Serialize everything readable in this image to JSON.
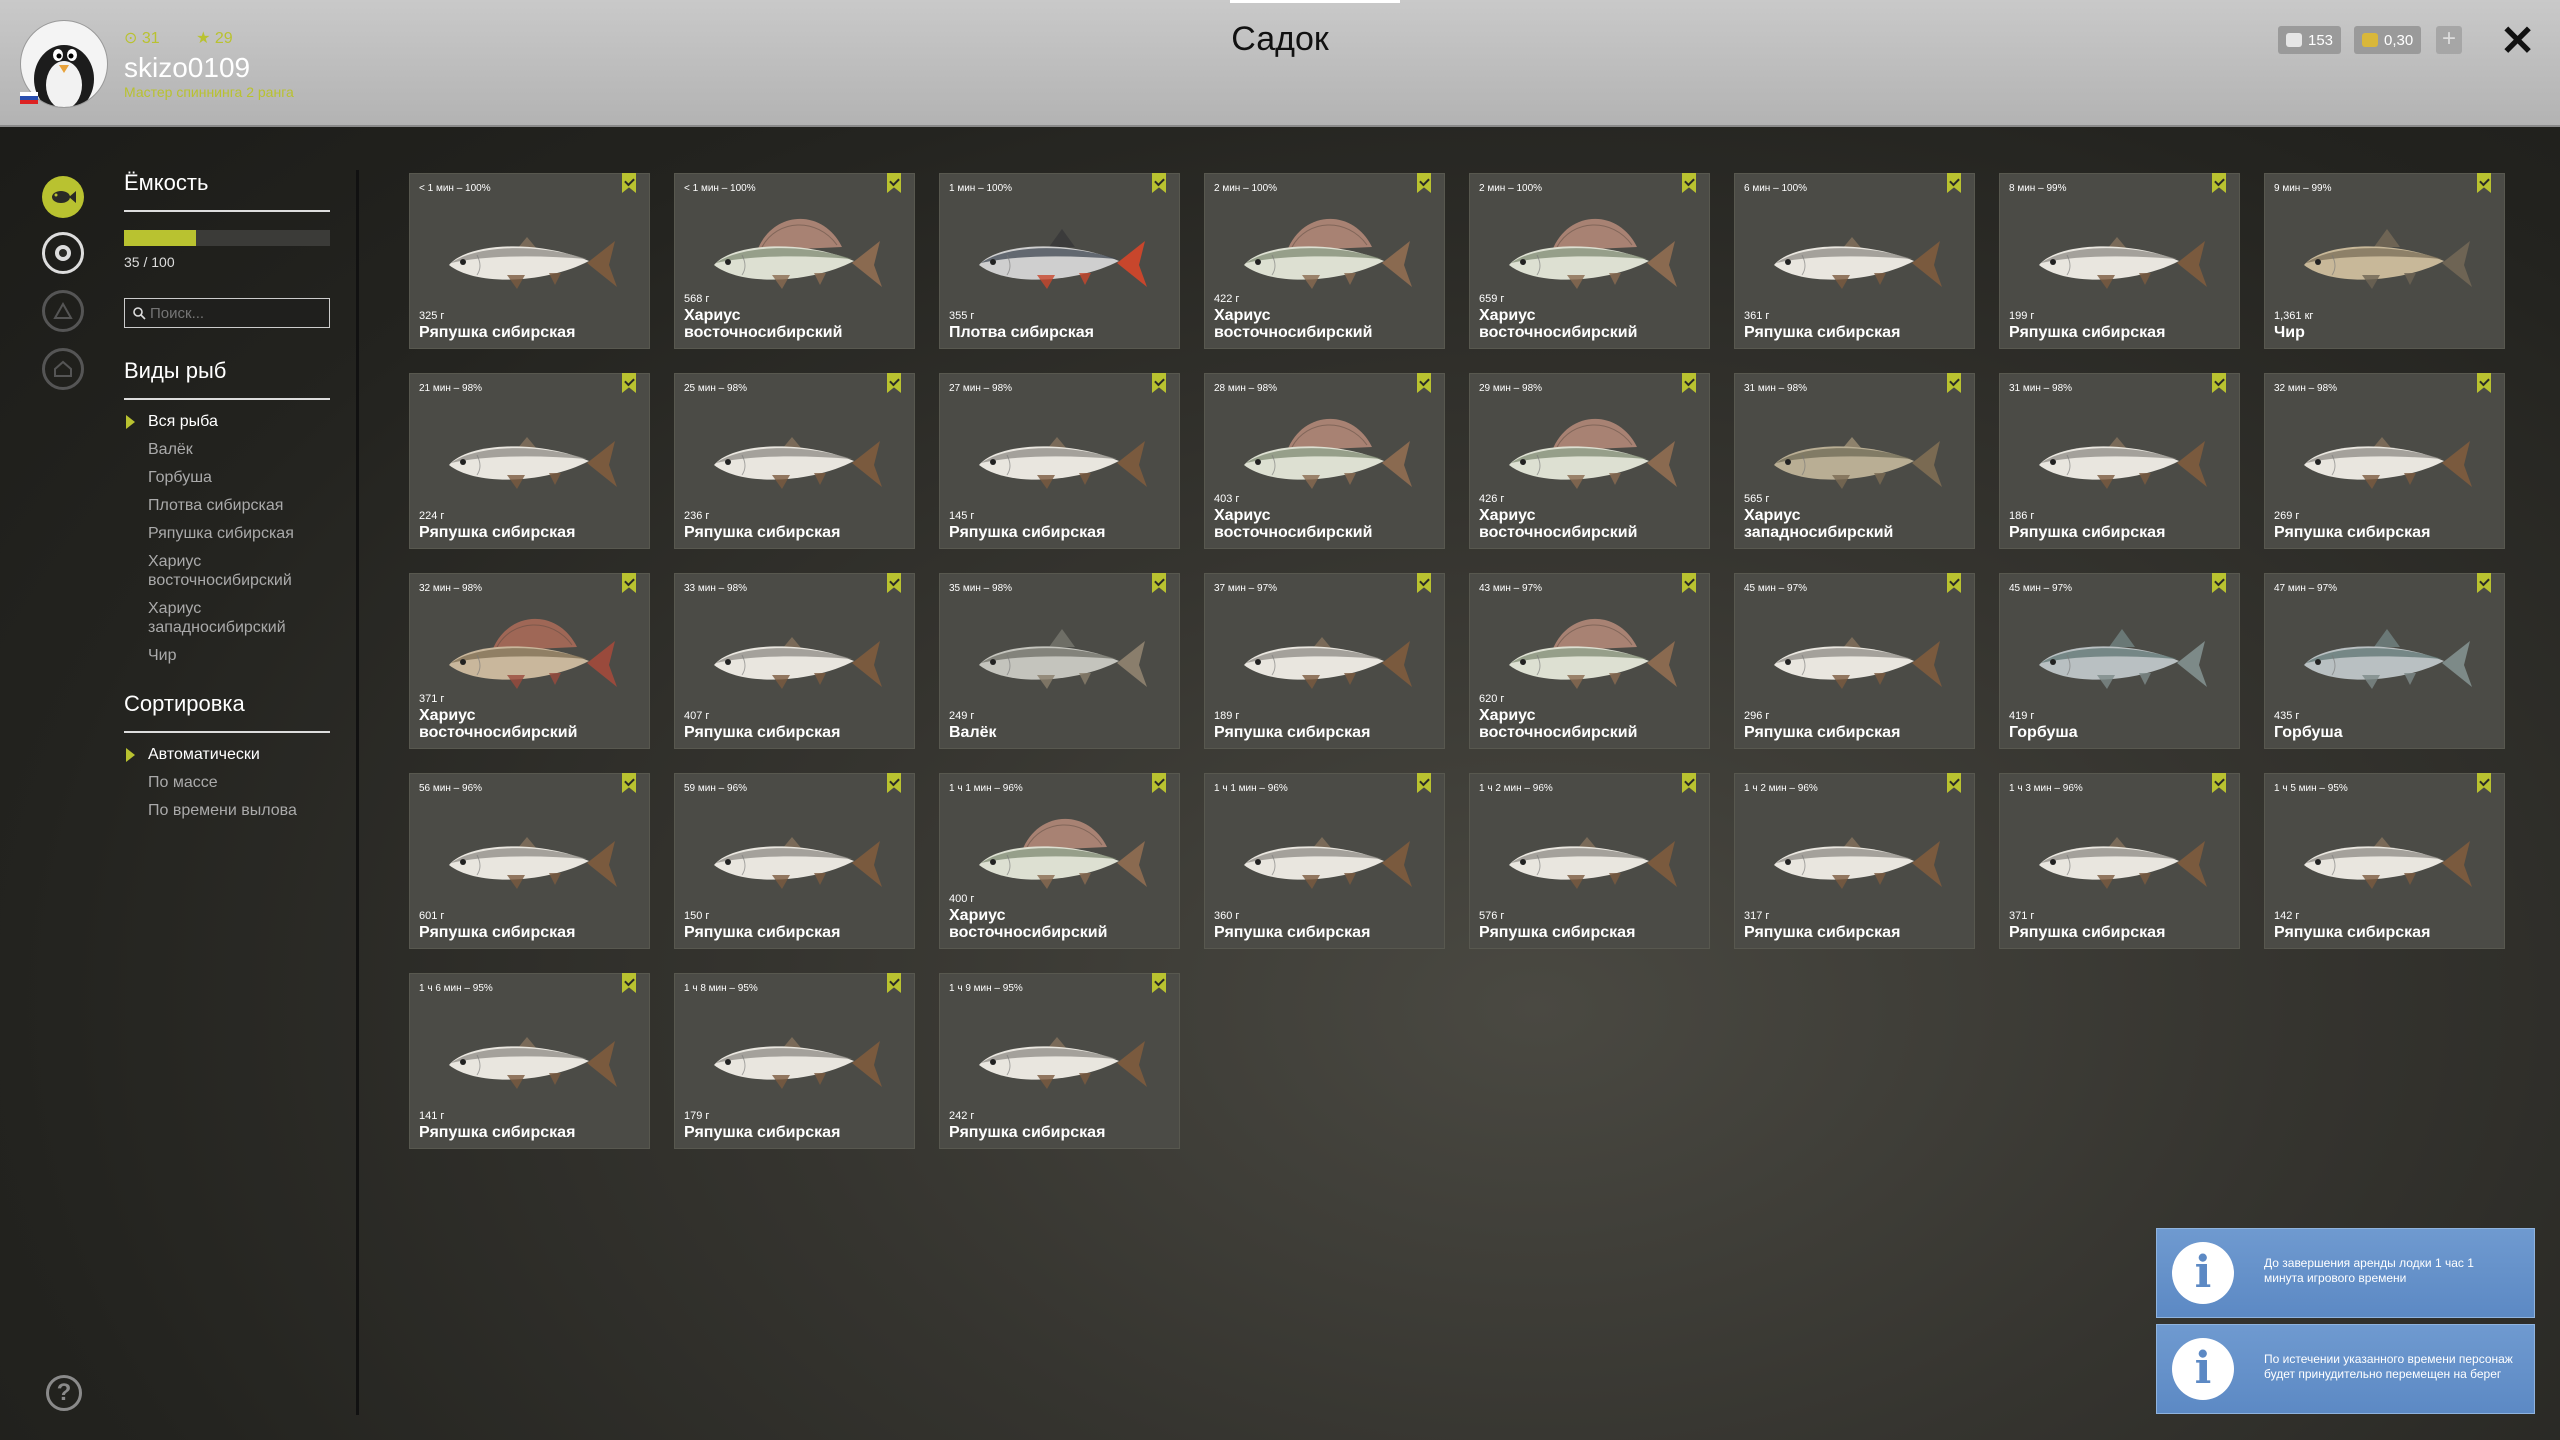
{
  "header": {
    "title": "Садок",
    "coins": "31",
    "stars": "29",
    "username": "skizo0109",
    "rank": "Мастер спиннинга 2 ранга",
    "silver": "153",
    "gold": "0,30"
  },
  "sidebar": {
    "capacity_title": "Ёмкость",
    "capacity_value": "35 / 100",
    "capacity_fraction": 0.35,
    "search_placeholder": "Поиск...",
    "species_title": "Виды рыб",
    "species": [
      "Вся рыба",
      "Валёк",
      "Горбуша",
      "Плотва сибирская",
      "Ряпушка сибирская",
      "Хариус восточносибирский",
      "Хариус западносибирский",
      "Чир"
    ],
    "sort_title": "Сортировка",
    "sort": [
      "Автоматически",
      "По массе",
      "По времени вылова"
    ]
  },
  "fish": [
    {
      "time": "< 1 мин – 100%",
      "weight": "325 г",
      "name": "Ряпушка сибирская",
      "kind": "ryap"
    },
    {
      "time": "< 1 мин – 100%",
      "weight": "568 г",
      "name": "Хариус восточносибирский",
      "kind": "harv"
    },
    {
      "time": "1 мин – 100%",
      "weight": "355 г",
      "name": "Плотва сибирская",
      "kind": "plot"
    },
    {
      "time": "2 мин – 100%",
      "weight": "422 г",
      "name": "Хариус восточносибирский",
      "kind": "harv"
    },
    {
      "time": "2 мин – 100%",
      "weight": "659 г",
      "name": "Хариус восточносибирский",
      "kind": "harv"
    },
    {
      "time": "6 мин – 100%",
      "weight": "361 г",
      "name": "Ряпушка сибирская",
      "kind": "ryap"
    },
    {
      "time": "8 мин – 99%",
      "weight": "199 г",
      "name": "Ряпушка сибирская",
      "kind": "ryap"
    },
    {
      "time": "9 мин – 99%",
      "weight": "1,361 кг",
      "name": "Чир",
      "kind": "chir"
    },
    {
      "time": "21 мин – 98%",
      "weight": "224 г",
      "name": "Ряпушка сибирская",
      "kind": "ryap"
    },
    {
      "time": "25 мин – 98%",
      "weight": "236 г",
      "name": "Ряпушка сибирская",
      "kind": "ryap"
    },
    {
      "time": "27 мин – 98%",
      "weight": "145 г",
      "name": "Ряпушка сибирская",
      "kind": "ryap"
    },
    {
      "time": "28 мин – 98%",
      "weight": "403 г",
      "name": "Хариус восточносибирский",
      "kind": "harv"
    },
    {
      "time": "29 мин – 98%",
      "weight": "426 г",
      "name": "Хариус восточносибирский",
      "kind": "harv"
    },
    {
      "time": "31 мин – 98%",
      "weight": "565 г",
      "name": "Хариус западносибирский",
      "kind": "harz"
    },
    {
      "time": "31 мин – 98%",
      "weight": "186 г",
      "name": "Ряпушка сибирская",
      "kind": "ryap"
    },
    {
      "time": "32 мин – 98%",
      "weight": "269 г",
      "name": "Ряпушка сибирская",
      "kind": "ryap"
    },
    {
      "time": "32 мин – 98%",
      "weight": "371 г",
      "name": "Хариус восточносибирский",
      "kind": "harr"
    },
    {
      "time": "33 мин – 98%",
      "weight": "407 г",
      "name": "Ряпушка сибирская",
      "kind": "ryap"
    },
    {
      "time": "35 мин – 98%",
      "weight": "249 г",
      "name": "Валёк",
      "kind": "valek"
    },
    {
      "time": "37 мин – 97%",
      "weight": "189 г",
      "name": "Ряпушка сибирская",
      "kind": "ryap"
    },
    {
      "time": "43 мин – 97%",
      "weight": "620 г",
      "name": "Хариус восточносибирский",
      "kind": "harv"
    },
    {
      "time": "45 мин – 97%",
      "weight": "296 г",
      "name": "Ряпушка сибирская",
      "kind": "ryap"
    },
    {
      "time": "45 мин – 97%",
      "weight": "419 г",
      "name": "Горбуша",
      "kind": "gorb"
    },
    {
      "time": "47 мин – 97%",
      "weight": "435 г",
      "name": "Горбуша",
      "kind": "gorb"
    },
    {
      "time": "56 мин – 96%",
      "weight": "601 г",
      "name": "Ряпушка сибирская",
      "kind": "ryap"
    },
    {
      "time": "59 мин – 96%",
      "weight": "150 г",
      "name": "Ряпушка сибирская",
      "kind": "ryap"
    },
    {
      "time": "1 ч 1 мин – 96%",
      "weight": "400 г",
      "name": "Хариус восточносибирский",
      "kind": "harv"
    },
    {
      "time": "1 ч 1 мин – 96%",
      "weight": "360 г",
      "name": "Ряпушка сибирская",
      "kind": "ryap"
    },
    {
      "time": "1 ч 2 мин – 96%",
      "weight": "576 г",
      "name": "Ряпушка сибирская",
      "kind": "ryap"
    },
    {
      "time": "1 ч 2 мин – 96%",
      "weight": "317 г",
      "name": "Ряпушка сибирская",
      "kind": "ryap"
    },
    {
      "time": "1 ч 3 мин – 96%",
      "weight": "371 г",
      "name": "Ряпушка сибирская",
      "kind": "ryap"
    },
    {
      "time": "1 ч 5 мин – 95%",
      "weight": "142 г",
      "name": "Ряпушка сибирская",
      "kind": "ryap"
    },
    {
      "time": "1 ч 6 мин – 95%",
      "weight": "141 г",
      "name": "Ряпушка сибирская",
      "kind": "ryap"
    },
    {
      "time": "1 ч 8 мин – 95%",
      "weight": "179 г",
      "name": "Ряпушка сибирская",
      "kind": "ryap"
    },
    {
      "time": "1 ч 9 мин – 95%",
      "weight": "242 г",
      "name": "Ряпушка сибирская",
      "kind": "ryap"
    }
  ],
  "fish_colors": {
    "ryap": {
      "body": "#e9e6df",
      "back": "#8c8a84",
      "fin": "#7a5a3e",
      "dorsal": "#7a6a58"
    },
    "harv": {
      "body": "#dde0d2",
      "back": "#7d8a72",
      "fin": "#8a6a50",
      "dorsal": "#b28878"
    },
    "harr": {
      "body": "#c9b79c",
      "back": "#7c6c52",
      "fin": "#9a4a3c",
      "dorsal": "#a86a58"
    },
    "harz": {
      "body": "#b9ae94",
      "back": "#6f6a56",
      "fin": "#7a6a52",
      "dorsal": "#8e826c"
    },
    "plot": {
      "body": "#cfcfcf",
      "back": "#3e4650",
      "fin": "#c8462c",
      "dorsal": "#3b3b3b"
    },
    "chir": {
      "body": "#c8b899",
      "back": "#7a6e58",
      "fin": "#6e6454",
      "dorsal": "#6e6454"
    },
    "valek": {
      "body": "#c4c4bd",
      "back": "#6e6e66",
      "fin": "#8a7e6c",
      "dorsal": "#6e6e66"
    },
    "gorb": {
      "body": "#b9c0c2",
      "back": "#5f7472",
      "fin": "#7d8a88",
      "dorsal": "#6a7876"
    }
  },
  "notifications": [
    {
      "text": "До завершения аренды лодки 1 час 1 минута игрового времени"
    },
    {
      "text": "По истечении указанного времени персонаж будет принудительно перемещен на берег"
    }
  ]
}
